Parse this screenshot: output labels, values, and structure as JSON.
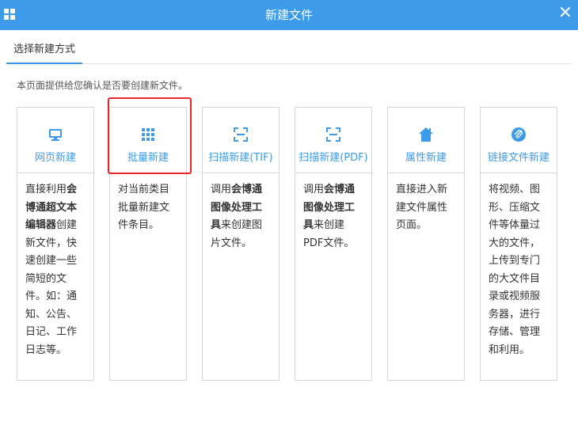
{
  "window": {
    "title": "新建文件",
    "close_icon": "close-icon",
    "app_icon": "grid-icon"
  },
  "tabs": [
    {
      "label": "选择新建方式",
      "active": true
    }
  ],
  "intro": "本页面提供给您确认是否要创建新文件。",
  "accent_color": "#3d9be9",
  "highlight_color": "#e8262b",
  "cards": [
    {
      "icon": "monitor-icon",
      "label": "网页新建",
      "desc": [
        {
          "t": "直接利用"
        },
        {
          "t": "会博通超文本编辑器",
          "b": true
        },
        {
          "t": "创建新文件，快速创建一些简短的文件。如：通知、公告、日记、工作日志等。"
        }
      ]
    },
    {
      "icon": "batch-grid-icon",
      "label": "批量新建",
      "highlighted": true,
      "desc": [
        {
          "t": "对当前类目批量新建文件条目。"
        }
      ]
    },
    {
      "icon": "scan-icon",
      "label": "扫描新建(TIF)",
      "desc": [
        {
          "t": "调用"
        },
        {
          "t": "会博通图像处理工具",
          "b": true
        },
        {
          "t": "来创建图片文件。"
        }
      ]
    },
    {
      "icon": "scan-icon",
      "label": "扫描新建(PDF)",
      "desc": [
        {
          "t": "调用"
        },
        {
          "t": "会博通图像处理工具",
          "b": true
        },
        {
          "t": "来创建PDF文件。"
        }
      ]
    },
    {
      "icon": "home-icon",
      "label": "属性新建",
      "desc": [
        {
          "t": "直接进入新建文件属性页面。"
        }
      ]
    },
    {
      "icon": "link-icon",
      "label": "链接文件新建",
      "desc": [
        {
          "t": "将视频、图形、压缩文件等体量过大的文件，上传到专门的大文件目录或视频服务器，进行存储、管理和利用。"
        }
      ]
    }
  ]
}
